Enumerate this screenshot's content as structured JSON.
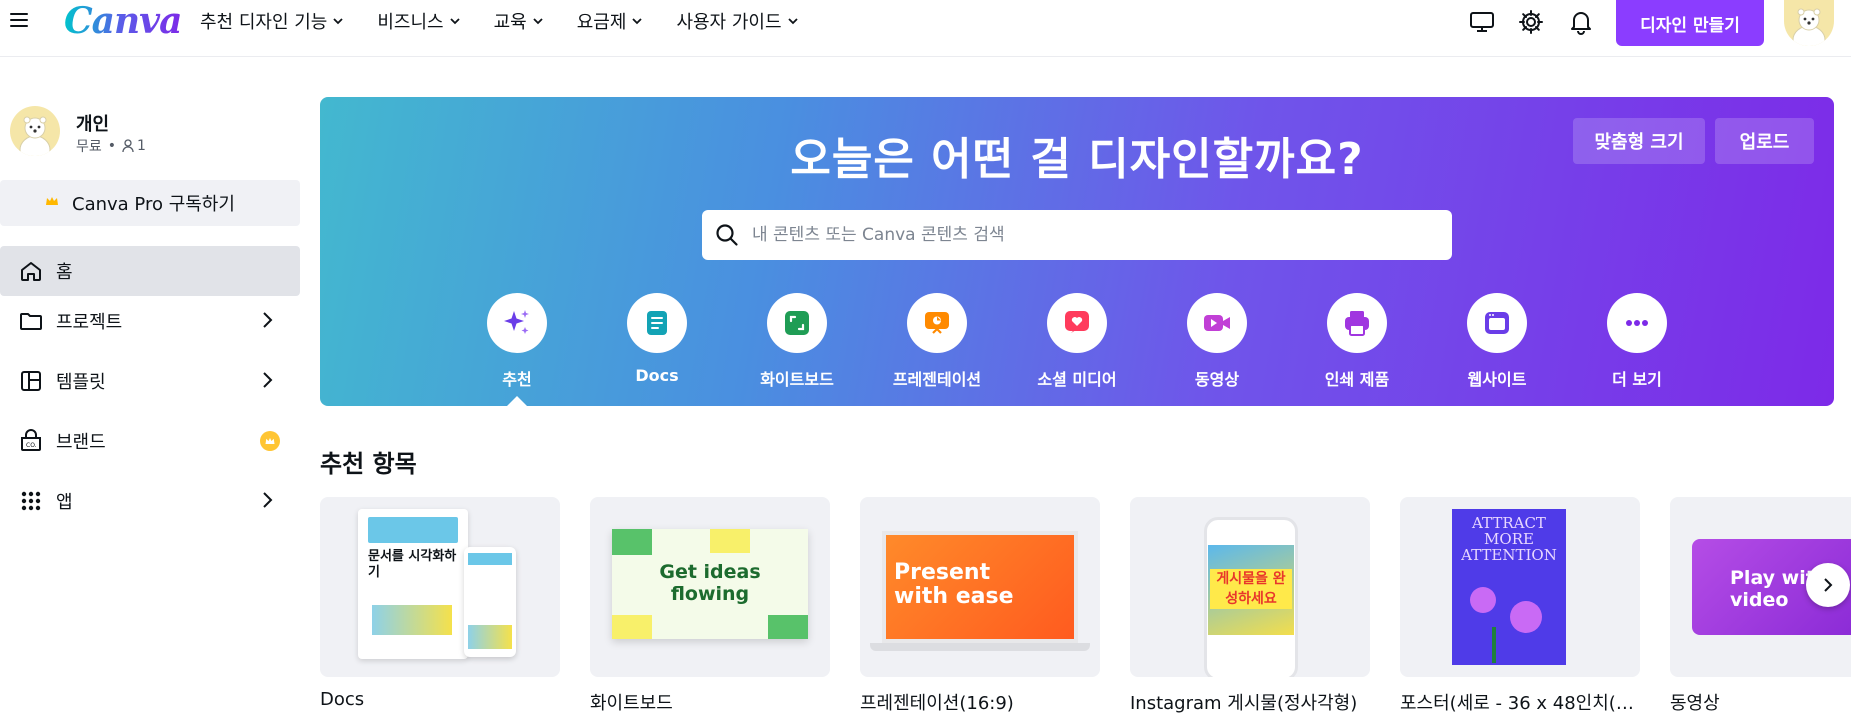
{
  "brand": {
    "logo": "Canva"
  },
  "topnav": [
    {
      "label": "추천 디자인 기능"
    },
    {
      "label": "비즈니스"
    },
    {
      "label": "교육"
    },
    {
      "label": "요금제"
    },
    {
      "label": "사용자 가이드"
    }
  ],
  "top_icons": [
    "desktop-icon",
    "gear-icon",
    "bell-icon"
  ],
  "create_button": "디자인 만들기",
  "account": {
    "name": "개인",
    "plan": "무료",
    "members": "1"
  },
  "pro_button": "Canva Pro 구독하기",
  "sidebar": [
    {
      "label": "홈",
      "icon": "home-icon",
      "active": true
    },
    {
      "label": "프로젝트",
      "icon": "folder-icon"
    },
    {
      "label": "템플릿",
      "icon": "template-icon"
    },
    {
      "label": "브랜드",
      "icon": "brand-icon"
    },
    {
      "label": "앱",
      "icon": "apps-grid-icon"
    }
  ],
  "hero": {
    "title": "오늘은 어떤 걸 디자인할까요?",
    "custom_size": "맞춤형 크기",
    "upload": "업로드",
    "search_placeholder": "내 콘텐츠 또는 Canva 콘텐츠 검색"
  },
  "categories": [
    {
      "label": "추천",
      "icon": "sparkle-icon",
      "color": "#7d2ae8"
    },
    {
      "label": "Docs",
      "icon": "docs-icon",
      "color": "#13a3b5"
    },
    {
      "label": "화이트보드",
      "icon": "whiteboard-icon",
      "color": "#1f9d55"
    },
    {
      "label": "프레젠테이션",
      "icon": "presentation-icon",
      "color": "#ff8a00"
    },
    {
      "label": "소셜 미디어",
      "icon": "heart-icon",
      "color": "#ff3b5c"
    },
    {
      "label": "동영상",
      "icon": "video-icon",
      "color": "#c13fd6"
    },
    {
      "label": "인쇄 제품",
      "icon": "printer-icon",
      "color": "#a036e0"
    },
    {
      "label": "웹사이트",
      "icon": "website-icon",
      "color": "#6a3de8"
    },
    {
      "label": "더 보기",
      "icon": "more-icon",
      "color": "#7d2ae8"
    }
  ],
  "recommended": {
    "title": "추천 항목",
    "items": [
      {
        "label": "Docs",
        "thumb_text": "문서를 시각화하기"
      },
      {
        "label": "화이트보드",
        "thumb_text": "Get ideas flowing"
      },
      {
        "label": "프레젠테이션(16:9)",
        "thumb_text": "Present with ease"
      },
      {
        "label": "Instagram 게시물(정사각형)",
        "thumb_text": "게시물을 완성하세요"
      },
      {
        "label": "포스터(세로 - 36 x 48인치(9...",
        "thumb_text": "ATTRACT MORE ATTENTION"
      },
      {
        "label": "동영상",
        "thumb_text": "Play with video"
      }
    ]
  }
}
